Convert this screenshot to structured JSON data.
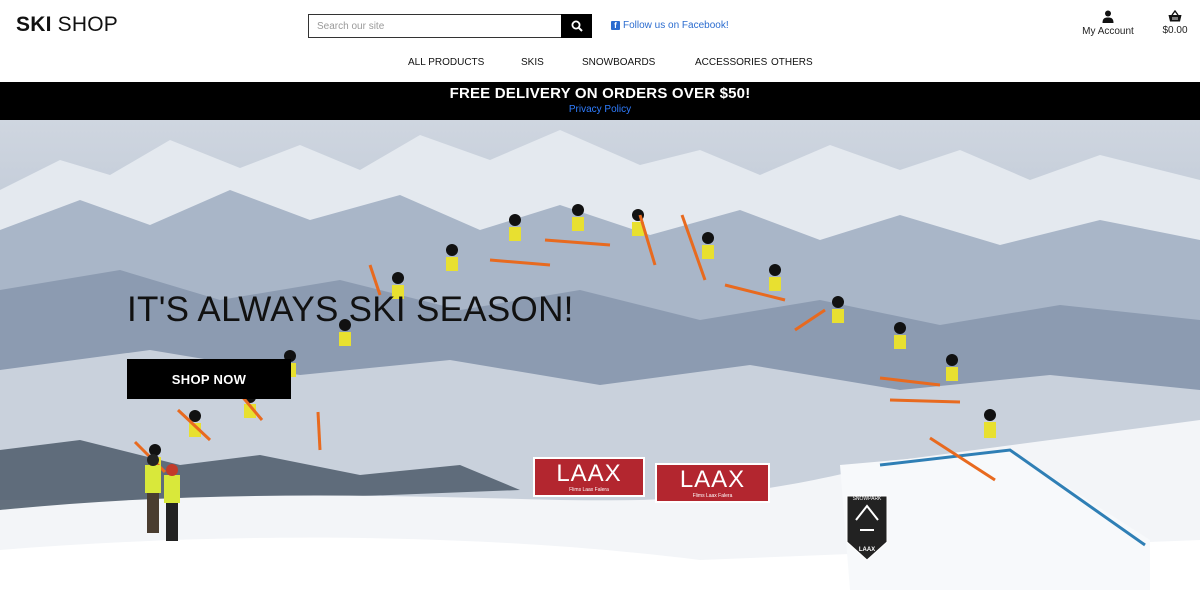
{
  "header": {
    "logo_bold": "SKI",
    "logo_rest": "SHOP",
    "search_placeholder": "Search our site",
    "facebook_text": "Follow us on Facebook!",
    "account_label": "My Account",
    "cart_total": "$0.00"
  },
  "nav": {
    "items": [
      {
        "label": "ALL PRODUCTS"
      },
      {
        "label": "SKIS"
      },
      {
        "label": "SNOWBOARDS"
      },
      {
        "label": "ACCESSORIES"
      },
      {
        "label": "OTHERS"
      }
    ]
  },
  "banner": {
    "promo": "FREE DELIVERY ON ORDERS OVER $50!",
    "privacy": "Privacy Policy"
  },
  "hero": {
    "title": "IT'S ALWAYS SKI SEASON!",
    "button": "SHOP NOW",
    "sign1": "LAAX",
    "sign1_sub": "Flims Laax Falera",
    "sign2": "LAAX",
    "sign2_sub": "Flims Laax Falera",
    "badge_top": "SNOWPARK",
    "badge_bottom": "LAAX"
  },
  "icons": {
    "search": "search-icon",
    "facebook": "facebook-icon",
    "account": "user-icon",
    "cart": "basket-icon"
  },
  "colors": {
    "black": "#000000",
    "link_blue": "#2f7dff",
    "laax_red": "#b3262f"
  }
}
